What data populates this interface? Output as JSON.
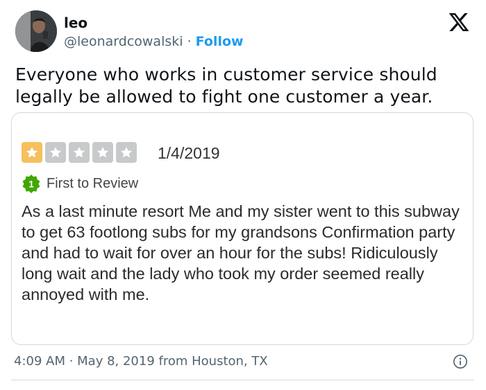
{
  "author": {
    "display_name": "leo",
    "handle": "@leonardcowalski",
    "separator": "·",
    "follow_label": "Follow"
  },
  "tweet": {
    "text": "Everyone who works in customer service should legally be allowed to fight one customer a year."
  },
  "review_card": {
    "rating": 1,
    "rating_max": 5,
    "date": "1/4/2019",
    "badge_number": "1",
    "badge_label": "First to Review",
    "text": "As a last minute resort Me and my sister went to this subway to get 63 footlong subs for my grandsons Confirmation party and had to wait for over an hour for the subs! Ridiculously long wait and the lady who took my order seemed really annoyed with me."
  },
  "meta": {
    "timestamp": "4:09 AM · May 8, 2019 from Houston, TX"
  },
  "icons": {
    "brand": "x-logo-icon",
    "info": "info-icon",
    "star": "star-icon",
    "badge": "first-to-review-badge-icon"
  },
  "colors": {
    "follow": "#1d9bf0",
    "star_filled": "#f5c05d",
    "star_empty": "#c8c9ca",
    "badge": "#41a700",
    "secondary_text": "#536471"
  }
}
